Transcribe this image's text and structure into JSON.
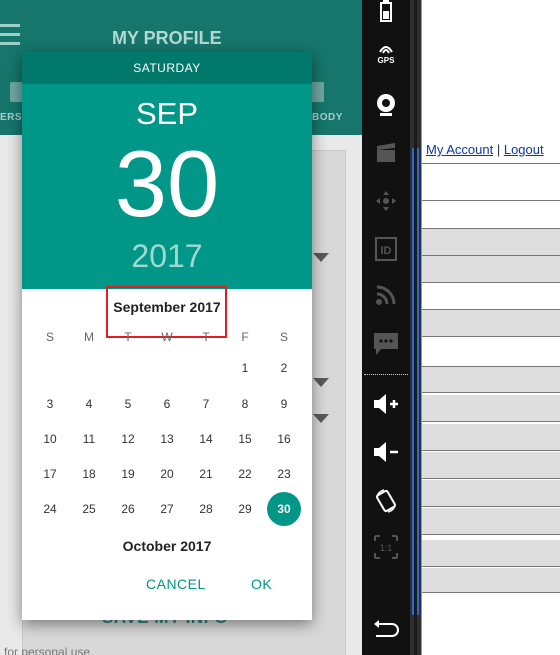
{
  "app": {
    "title": "MY PROFILE",
    "tab_left_label": "ERSO",
    "tab_right_label": "BODY",
    "save_button_label": "SAVE MY INFO",
    "footer_note": "for personal use"
  },
  "datepicker": {
    "weekday_header": "SATURDAY",
    "selected_month": "SEP",
    "selected_day": "30",
    "selected_year": "2017",
    "current_month_title": "September 2017",
    "next_month_title": "October 2017",
    "weekday_labels": [
      "S",
      "M",
      "T",
      "W",
      "T",
      "F",
      "S"
    ],
    "days": [
      "1",
      "2",
      "3",
      "4",
      "5",
      "6",
      "7",
      "8",
      "9",
      "10",
      "11",
      "12",
      "13",
      "14",
      "15",
      "16",
      "17",
      "18",
      "19",
      "20",
      "21",
      "22",
      "23",
      "24",
      "25",
      "26",
      "27",
      "28",
      "29",
      "30"
    ],
    "selected_value": "30",
    "cancel_label": "CANCEL",
    "ok_label": "OK",
    "accent_color": "#009688",
    "highlight_color": "#e02020"
  },
  "emulator_toolbar": {
    "items": [
      "battery-icon",
      "gps-icon",
      "webcam-icon",
      "movie-icon",
      "dpad-icon",
      "id-icon",
      "rss-icon",
      "sms-icon",
      "volume-up-icon",
      "volume-down-icon",
      "rotate-icon",
      "scale-icon",
      "back-icon"
    ],
    "gps_label": "GPS",
    "id_label": "ID",
    "scale_label": "1:1"
  },
  "browser": {
    "my_account_link": "My Account",
    "separator": "|",
    "logout_link": "Logout"
  }
}
